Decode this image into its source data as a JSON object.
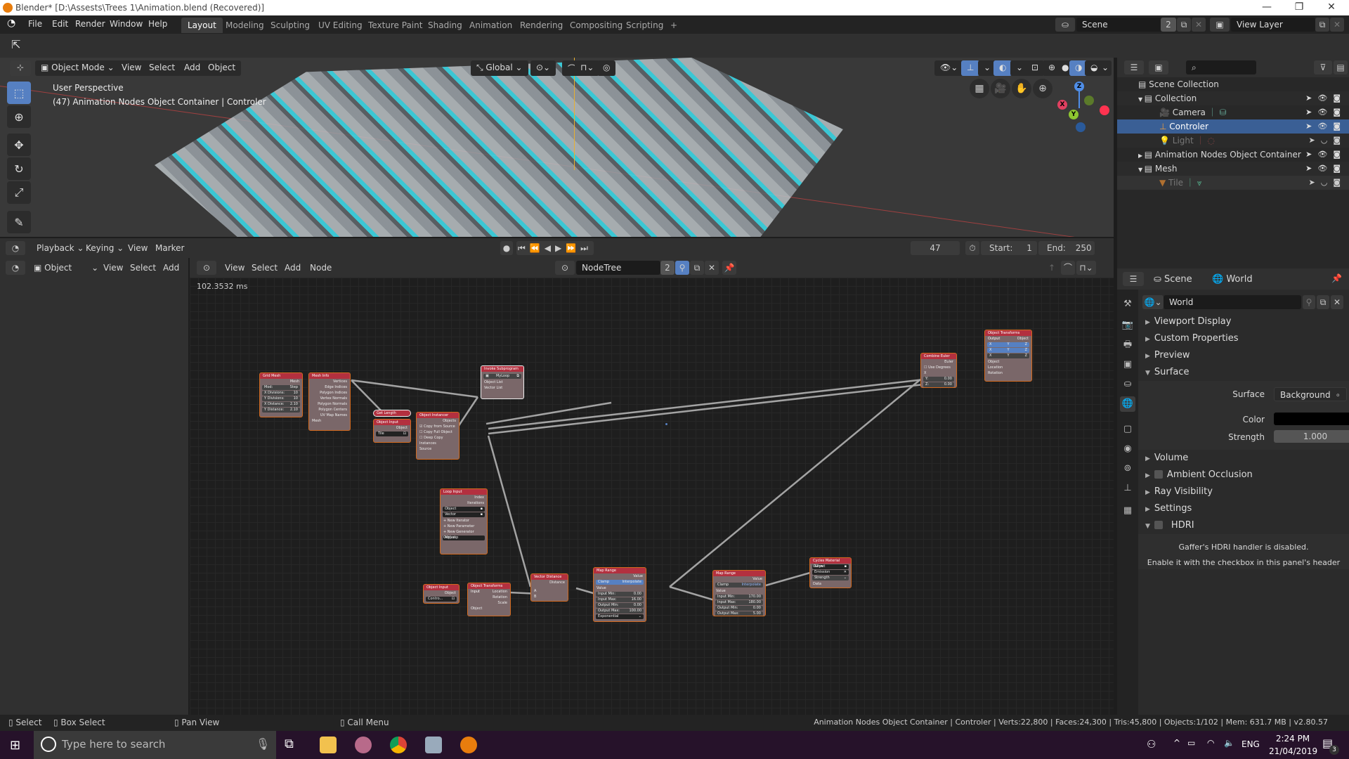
{
  "window": {
    "title": "Blender* [D:\\Assests\\Trees 1\\Animation.blend (Recovered)]",
    "controls": [
      "minimize",
      "maximize",
      "close"
    ]
  },
  "menubar": {
    "items": [
      "File",
      "Edit",
      "Render",
      "Window",
      "Help"
    ],
    "workspaces": [
      "Layout",
      "Modeling",
      "Sculpting",
      "UV Editing",
      "Texture Paint",
      "Shading",
      "Animation",
      "Rendering",
      "Compositing",
      "Scripting"
    ],
    "active_workspace": "Layout",
    "add_tab": "+",
    "scene_name": "Scene",
    "scene_users": "2",
    "view_layer": "View Layer"
  },
  "viewport": {
    "mode": "Object Mode",
    "menus": [
      "View",
      "Select",
      "Add",
      "Object"
    ],
    "orientation": "Global",
    "overlay_line1": "User Perspective",
    "overlay_line2": "(47) Animation Nodes Object Container | Controler",
    "tools": [
      "select-box",
      "cursor",
      "move",
      "rotate",
      "scale",
      "annotate"
    ],
    "gizmo_axes": [
      "X",
      "Y",
      "Z"
    ]
  },
  "outliner": {
    "search_placeholder": "",
    "rows": [
      {
        "label": "Scene Collection",
        "icon": "collection",
        "depth": 0,
        "selected": false,
        "dim": false
      },
      {
        "label": "Collection",
        "icon": "collection",
        "depth": 1,
        "selected": false,
        "dim": false,
        "expanded": true
      },
      {
        "label": "Camera",
        "icon": "camera",
        "depth": 2,
        "selected": false,
        "dim": false
      },
      {
        "label": "Controler",
        "icon": "empty",
        "depth": 2,
        "selected": true,
        "dim": false
      },
      {
        "label": "Light",
        "icon": "light",
        "depth": 2,
        "selected": false,
        "dim": true
      },
      {
        "label": "Animation Nodes Object Container",
        "icon": "collection",
        "depth": 1,
        "selected": false,
        "dim": false,
        "expanded": false
      },
      {
        "label": "Mesh",
        "icon": "collection",
        "depth": 1,
        "selected": false,
        "dim": false,
        "expanded": true
      },
      {
        "label": "Tile",
        "icon": "mesh",
        "depth": 2,
        "selected": false,
        "dim": true
      }
    ]
  },
  "timeline": {
    "menus": [
      "Playback",
      "Keying",
      "View",
      "Marker"
    ],
    "current_frame": "47",
    "start_label": "Start:",
    "start": "1",
    "end_label": "End:",
    "end": "250"
  },
  "node_editor": {
    "left_header": {
      "mode": "Object",
      "menus": [
        "View",
        "Select",
        "Add"
      ]
    },
    "menus": [
      "View",
      "Select",
      "Add",
      "Node"
    ],
    "tree_name": "NodeTree",
    "tree_users": "2",
    "exec_time": "102.3532 ms",
    "nodes": [
      {
        "id": "grid-mesh",
        "title": "Grid Mesh",
        "rows_right": [
          "Mesh"
        ],
        "fields": [
          [
            "Mod:",
            "Step"
          ],
          [
            "X Divisions:",
            "10"
          ],
          [
            "Y Divisions:",
            "10"
          ],
          [
            "X Distance:",
            "2.10"
          ],
          [
            "Y Distance:",
            "2.10"
          ]
        ]
      },
      {
        "id": "mesh-info",
        "title": "Mesh Info",
        "rows_right": [
          "Vertices",
          "Edge Indices",
          "Polygon Indices",
          "Vertex Normals",
          "Polygon Normals",
          "Polygon Centers",
          "UV Map Names"
        ],
        "rows_left": [
          "Mesh"
        ]
      },
      {
        "id": "get-length",
        "title": "Get Length"
      },
      {
        "id": "object-input-1",
        "title": "Object Input",
        "rows_right": [
          "Object"
        ],
        "fields": [
          [
            "Tile",
            ""
          ]
        ]
      },
      {
        "id": "object-instancer",
        "title": "Object Instancer",
        "rows_right": [
          "Objects"
        ],
        "checks": [
          "Copy from Source",
          "Copy Full Object",
          "Deep Copy"
        ],
        "rows_left": [
          "Instances",
          "Source"
        ]
      },
      {
        "id": "invoke-subprogram",
        "title": "Invoke Subprogram",
        "fields": [
          [
            "MyLoop",
            ""
          ]
        ],
        "rows_left": [
          "Object List",
          "Vector List"
        ]
      },
      {
        "id": "loop-input",
        "title": "Loop Input",
        "rows_right": [
          "Index",
          "Iterations"
        ],
        "fields": [
          [
            "Object",
            ""
          ],
          [
            "Vector",
            ""
          ]
        ],
        "rows_left": [
          "New Iterator",
          "New Parameter",
          "New Generator Output",
          "MyLoop"
        ]
      },
      {
        "id": "object-input-2",
        "title": "Object Input",
        "rows_right": [
          "Object"
        ],
        "fields": [
          [
            "Contro...",
            ""
          ]
        ]
      },
      {
        "id": "object-transforms-input",
        "title": "Object Transforms Input",
        "rows_right": [
          "Location",
          "Rotation",
          "Scale"
        ],
        "rows_left": [
          "Object"
        ]
      },
      {
        "id": "vector-distance",
        "title": "Vector Distance",
        "rows_right": [
          "Distance"
        ],
        "rows_left": [
          "A",
          "B"
        ]
      },
      {
        "id": "map-range-1",
        "title": "Map Range",
        "rows_right": [
          "Value"
        ],
        "toggles": [
          "Clamp",
          "Interpolate"
        ],
        "rows_left": [
          "Value"
        ],
        "fields": [
          [
            "Input Min:",
            "0.00"
          ],
          [
            "Input Max:",
            "16.00"
          ],
          [
            "Output Min:",
            "0.00"
          ],
          [
            "Output Max:",
            "100.00"
          ],
          [
            "Exponential",
            ""
          ]
        ]
      },
      {
        "id": "map-range-2",
        "title": "Map Range",
        "rows_right": [
          "Value"
        ],
        "toggles": [
          "Clamp",
          "Interpolate"
        ],
        "rows_left": [
          "Value"
        ],
        "fields": [
          [
            "Input Min:",
            "170.00"
          ],
          [
            "Input Max:",
            "180.00"
          ],
          [
            "Output Min:",
            "0.00"
          ],
          [
            "Output Max:",
            "5.00"
          ]
        ]
      },
      {
        "id": "cycles-material-output",
        "title": "Cycles Material Output",
        "fields": [
          [
            "Glow",
            ""
          ],
          [
            "Emission",
            ""
          ],
          [
            "Strength",
            ""
          ]
        ],
        "rows_left": [
          "Data"
        ]
      },
      {
        "id": "combine-euler",
        "title": "Combine Euler",
        "rows_right": [
          "Euler"
        ],
        "checks": [
          "Use Degrees"
        ],
        "rows_left": [
          "X"
        ],
        "fields": [
          [
            "Y:",
            "0.00"
          ],
          [
            "Z:",
            "0.00"
          ]
        ]
      },
      {
        "id": "object-transforms-output",
        "title": "Object Transforms Output",
        "rows_right": [
          "Object"
        ],
        "xyz": [
          [
            "X",
            "Y",
            "Z"
          ],
          [
            "X",
            "Y",
            "Z"
          ],
          [
            "X",
            "Y",
            "Z"
          ]
        ],
        "rows_left": [
          "Object",
          "Location",
          "Rotation"
        ]
      }
    ]
  },
  "properties": {
    "context_scene": "Scene",
    "context_world": "World",
    "world_name": "World",
    "sections": [
      {
        "label": "Viewport Display",
        "expanded": false
      },
      {
        "label": "Custom Properties",
        "expanded": false
      },
      {
        "label": "Preview",
        "expanded": false
      },
      {
        "label": "Surface",
        "expanded": true
      }
    ],
    "surface": {
      "surface_label": "Surface",
      "surface_value": "Background",
      "color_label": "Color",
      "color_value": "#000000",
      "strength_label": "Strength",
      "strength_value": "1.000"
    },
    "sections_after": [
      {
        "label": "Volume",
        "expanded": false,
        "checkbox": false
      },
      {
        "label": "Ambient Occlusion",
        "expanded": false,
        "checkbox": true
      },
      {
        "label": "Ray Visibility",
        "expanded": false,
        "checkbox": false
      },
      {
        "label": "Settings",
        "expanded": false,
        "checkbox": false
      },
      {
        "label": "HDRI",
        "expanded": true,
        "checkbox": true
      }
    ],
    "hdri_msg1": "Gaffer's HDRI handler is disabled.",
    "hdri_msg2": "Enable it with the checkbox in this panel's header",
    "tabs": [
      "tool",
      "render",
      "output",
      "view-layer",
      "scene",
      "world",
      "object",
      "physics",
      "constraints",
      "data",
      "texture"
    ],
    "active_tab": "world"
  },
  "statusbar": {
    "select": "Select",
    "box_select": "Box Select",
    "pan_view": "Pan View",
    "call_menu": "Call Menu",
    "stats": "Animation Nodes Object Container | Controler | Verts:22,800 | Faces:24,300 | Tris:45,800 | Objects:1/102 | Mem: 631.7 MB | v2.80.57"
  },
  "taskbar": {
    "search_placeholder": "Type here to search",
    "apps": [
      "task-view",
      "file-explorer",
      "snipping-tool",
      "chrome",
      "resource-monitor",
      "blender"
    ],
    "language": "ENG",
    "time": "2:24 PM",
    "date": "21/04/2019",
    "notifications": "3"
  },
  "colors": {
    "accent": "#5680c2",
    "selected_row": "#3a5f95",
    "node_header": "#b3303f",
    "node_body": "#7a6769",
    "node_border": "#d2691e",
    "taskbar": "#26122a"
  }
}
